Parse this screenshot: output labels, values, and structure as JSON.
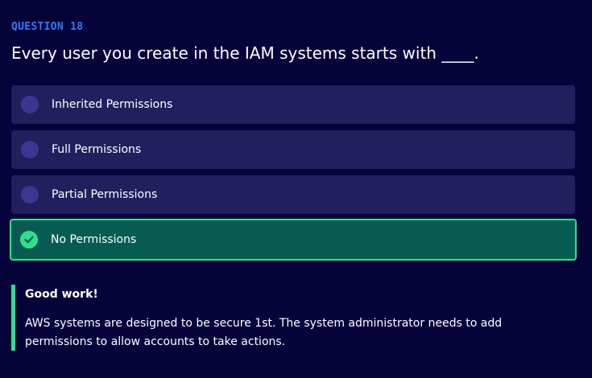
{
  "question": {
    "number_label": "QUESTION 18",
    "text": "Every user you create in the IAM systems starts with ____."
  },
  "options": [
    {
      "label": "Inherited Permissions",
      "selected": false
    },
    {
      "label": "Full Permissions",
      "selected": false
    },
    {
      "label": "Partial Permissions",
      "selected": false
    },
    {
      "label": "No Permissions",
      "selected": true,
      "correct": true
    }
  ],
  "feedback": {
    "title": "Good work!",
    "body": "AWS systems are designed to be secure 1st. The system administrator needs to add permissions to allow accounts to take actions."
  },
  "colors": {
    "background": "#05033a",
    "question_label": "#2f7cf6",
    "option_bg": "#221f5e",
    "radio": "#3d3690",
    "correct_bg": "#065c53",
    "correct_accent": "#2fe08a"
  },
  "icons": {
    "correct_option": "check-circle-icon",
    "unselected_option": "radio-circle-icon"
  }
}
